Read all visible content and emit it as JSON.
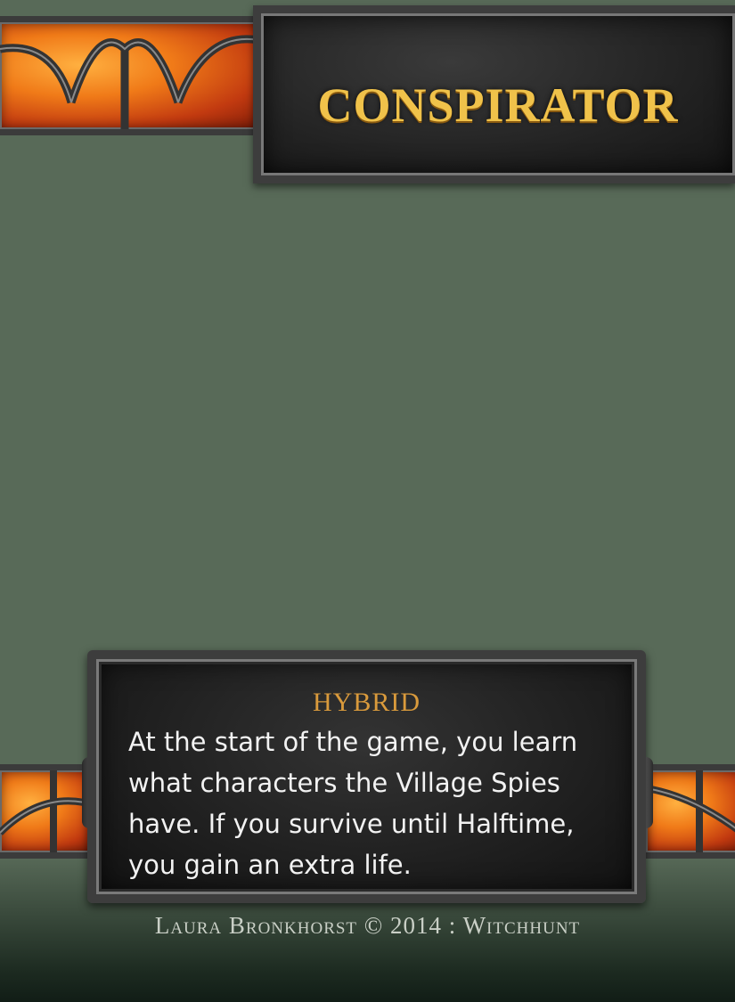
{
  "card": {
    "title": "Conspirator",
    "ability_type": "HYBRID",
    "ability_text": "At the start of the game, you learn what characters the Village Spies have. If you survive until Halftime, you gain an extra life.",
    "credit": "Laura Bronkhorst © 2014 : Witchhunt"
  },
  "colors": {
    "background": "#586a58",
    "title_gold": "#f0c24a",
    "ability_type": "#d99a3c",
    "glass_orange": "#f07a18",
    "frame_dark": "#222222"
  }
}
